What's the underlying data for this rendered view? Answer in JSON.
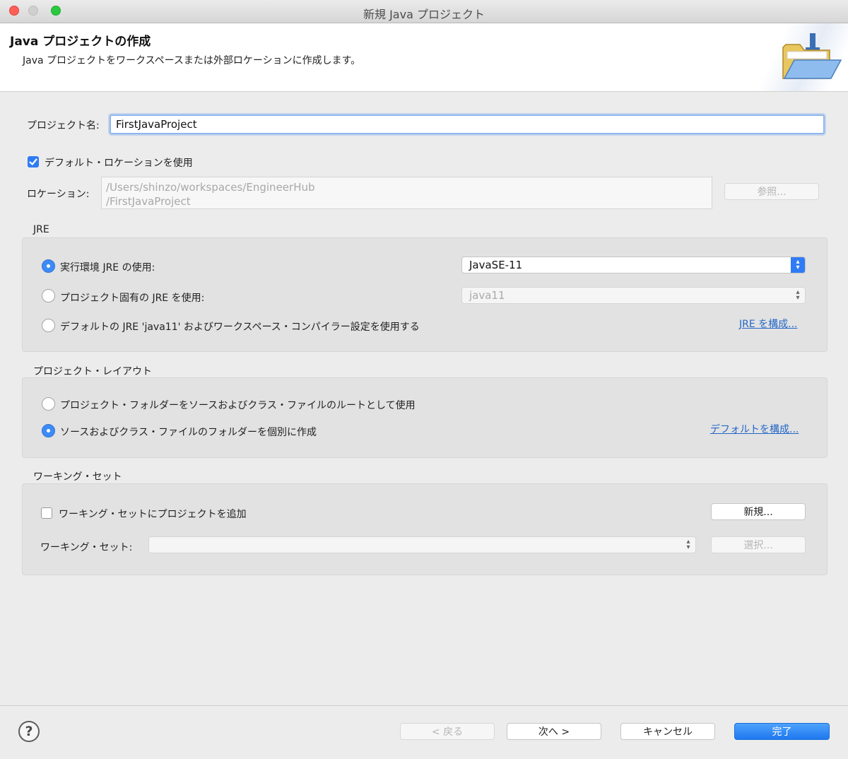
{
  "window": {
    "title": "新規 Java プロジェクト"
  },
  "header": {
    "title": "Java プロジェクトの作成",
    "description": "Java プロジェクトをワークスペースまたは外部ロケーションに作成します。",
    "icon": "folder-icon"
  },
  "project": {
    "name_label": "プロジェクト名:",
    "name_value": "FirstJavaProject"
  },
  "location": {
    "use_default_label": "デフォルト・ロケーションを使用",
    "use_default_checked": true,
    "label": "ロケーション:",
    "path_line1": "/Users/shinzo/workspaces/EngineerHub",
    "path_line2": "/FirstJavaProject",
    "browse_label": "参照..."
  },
  "jre": {
    "group_title": "JRE",
    "options": [
      {
        "label": "実行環境 JRE の使用:",
        "selected": true
      },
      {
        "label": "プロジェクト固有の JRE を使用:",
        "selected": false
      },
      {
        "label": "デフォルトの JRE 'java11' およびワークスペース・コンパイラー設定を使用する",
        "selected": false
      }
    ],
    "exec_env_value": "JavaSE-11",
    "project_jre_value": "java11",
    "configure_link": "JRE を構成..."
  },
  "layout": {
    "group_title": "プロジェクト・レイアウト",
    "options": [
      {
        "label": "プロジェクト・フォルダーをソースおよびクラス・ファイルのルートとして使用",
        "selected": false
      },
      {
        "label": "ソースおよびクラス・ファイルのフォルダーを個別に作成",
        "selected": true
      }
    ],
    "configure_link": "デフォルトを構成..."
  },
  "working_sets": {
    "group_title": "ワーキング・セット",
    "add_label": "ワーキング・セットにプロジェクトを追加",
    "add_checked": false,
    "new_button": "新規...",
    "sets_label": "ワーキング・セット:",
    "sets_value": "",
    "select_button": "選択..."
  },
  "footer": {
    "help_icon": "help-icon",
    "back": "< 戻る",
    "next": "次へ >",
    "cancel": "キャンセル",
    "finish": "完了"
  },
  "colors": {
    "accent": "#2f7bf5",
    "link": "#2467c7",
    "close": "#fe5f57",
    "maximize": "#2bc840"
  }
}
